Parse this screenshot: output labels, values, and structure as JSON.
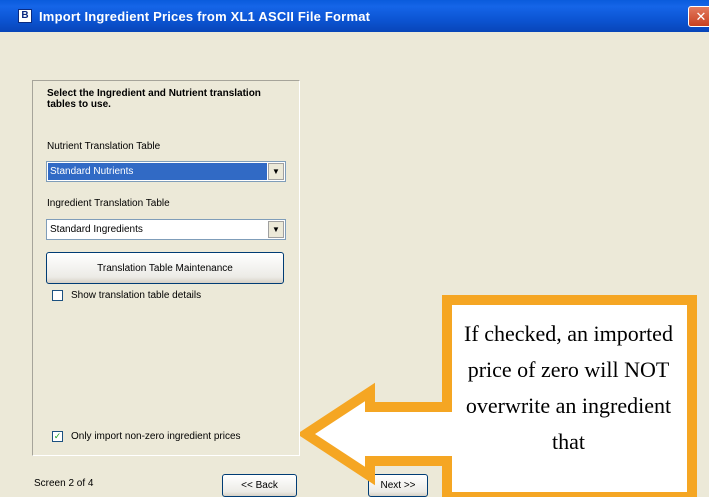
{
  "window": {
    "title": "Import Ingredient Prices from XL1 ASCII File Format",
    "app_icon_glyph": "B",
    "close_glyph": "✕",
    "titlebar_color": "#0A5BDC",
    "face_color": "#ECE9D8"
  },
  "form": {
    "instructions": "Select the Ingredient and Nutrient translation tables to use.",
    "nutrient_label": "Nutrient Translation Table",
    "nutrient_value": "Standard Nutrients",
    "ingredient_label": "Ingredient Translation Table",
    "ingredient_value": "Standard Ingredients",
    "dropdown_glyph": "▼",
    "translation_button": "Translation Table Maintenance",
    "show_details_label": "Show translation table details",
    "show_details_checked": false,
    "only_import_label": "Only import non-zero ingredient prices",
    "only_import_checked": true,
    "check_glyph": "✓"
  },
  "footer": {
    "screen_label": "Screen 2 of 4",
    "back_button": "<< Back",
    "next_button": "Next >>"
  },
  "callout": {
    "text": "If checked, an imported price of zero will NOT overwrite an ingredient that",
    "box_color": "#F5A623",
    "fill_color": "#FFFFFF"
  }
}
